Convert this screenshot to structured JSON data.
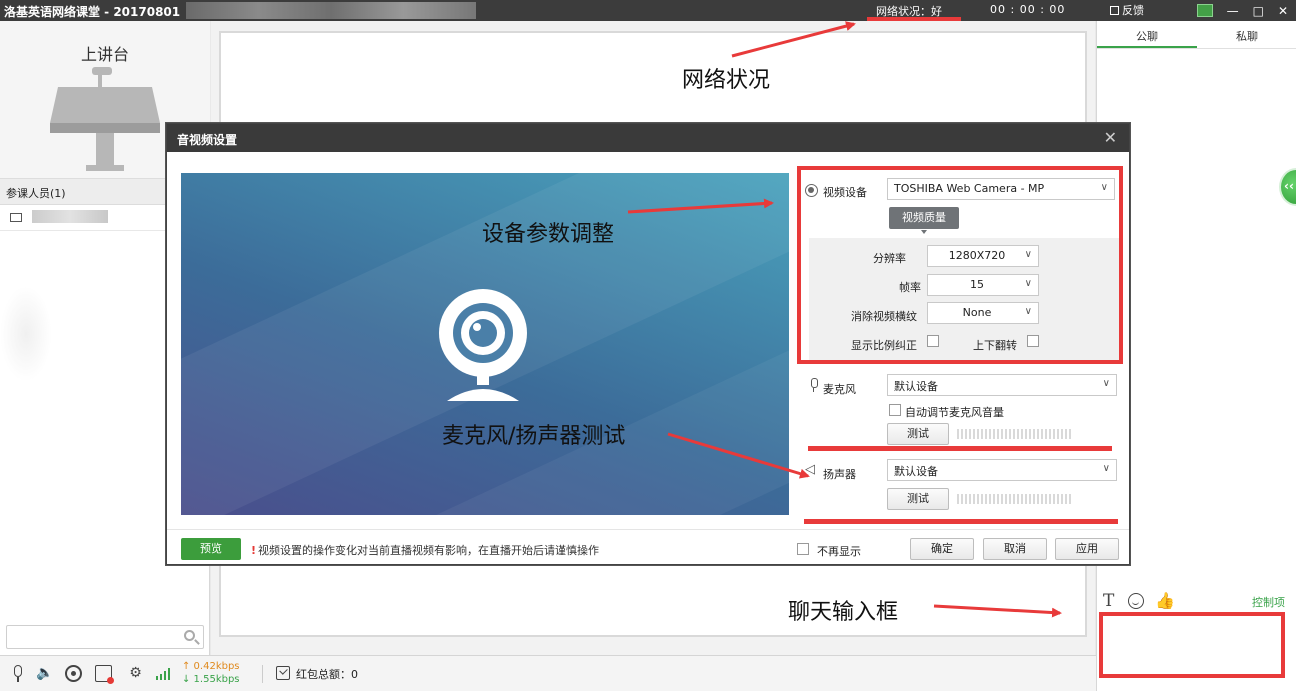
{
  "titlebar": {
    "app_title": "洛基英语网络课堂 - 20170801",
    "network_status": "网络状况：好",
    "timer": "00 : 00 : 00",
    "feedback": "反馈",
    "minimize": "—",
    "maximize": "□",
    "close": "✕"
  },
  "left_panel": {
    "podium_label": "上讲台",
    "members_header": "参课人员(1)"
  },
  "chat": {
    "tabs": [
      "公聊",
      "私聊"
    ],
    "format_icon_text": "T",
    "like_icon_text": "👍",
    "control_link": "控制项"
  },
  "bottom_bar": {
    "upload_rate": "↑ 0.42kbps",
    "download_rate": "↓ 1.55kbps",
    "red_packet": "红包总额：0"
  },
  "dialog": {
    "title": "音视频设置",
    "close": "✕",
    "video_device_label": "视频设备",
    "video_device_value": "TOSHIBA Web Camera - MP",
    "quality_button": "视频质量",
    "resolution_label": "分辨率",
    "resolution_value": "1280X720",
    "framerate_label": "帧率",
    "framerate_value": "15",
    "flicker_label": "消除视频横纹",
    "flicker_value": "None",
    "aspect_label": "显示比例纠正",
    "flip_label": "上下翻转",
    "mic_label": "麦克风",
    "mic_value": "默认设备",
    "auto_mic_label": "自动调节麦克风音量",
    "mic_test": "测试",
    "speaker_label": "扬声器",
    "speaker_value": "默认设备",
    "speaker_test": "测试",
    "preview_button": "预览",
    "warning": "视频设置的操作变化对当前直播视频有影响，在直播开始后请谨慎操作",
    "warning_mark": "!",
    "dont_show": "不再显示",
    "ok": "确定",
    "cancel": "取消",
    "apply": "应用",
    "chevron": "∨"
  },
  "annotations": {
    "network": "网络状况",
    "device_params": "设备参数调整",
    "mic_speaker": "麦克风/扬声器测试",
    "chat_input": "聊天输入框"
  },
  "colors": {
    "annotation_red": "#e83a3a",
    "accent_green": "#3aa34a",
    "titlebar": "#3c3c3c"
  }
}
